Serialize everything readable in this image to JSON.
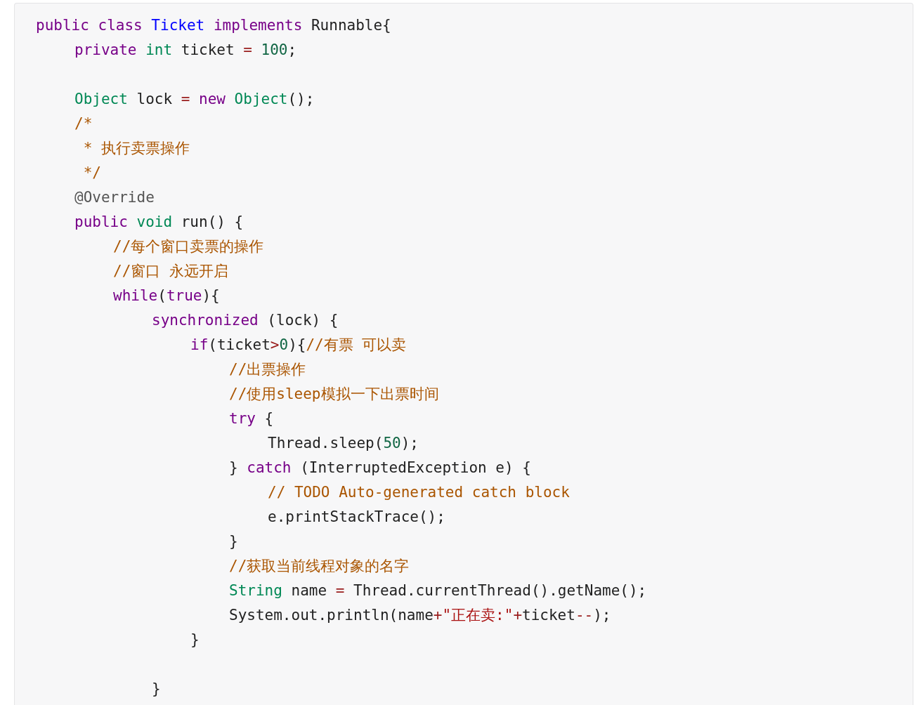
{
  "code_block": {
    "lines": [
      {
        "kind": "code",
        "tokens": [
          {
            "t": "public",
            "kind": "keyword"
          },
          {
            "t": " class",
            "kind": "keyword"
          },
          {
            "t": " Ticket",
            "kind": "classname"
          },
          {
            "t": " implements",
            "kind": "keyword"
          },
          {
            "t": " Runnable{",
            "kind": "plain"
          }
        ],
        "children": [
          {
            "kind": "code",
            "tokens": [
              {
                "t": "private",
                "kind": "keyword"
              },
              {
                "t": " int",
                "kind": "type"
              },
              {
                "t": " ticket ",
                "kind": "plain"
              },
              {
                "t": "=",
                "kind": "operator"
              },
              {
                "t": " 100",
                "kind": "number"
              },
              {
                "t": ";",
                "kind": "plain"
              }
            ]
          },
          {
            "kind": "blank"
          },
          {
            "kind": "code",
            "tokens": [
              {
                "t": "Object",
                "kind": "type"
              },
              {
                "t": " lock ",
                "kind": "plain"
              },
              {
                "t": "=",
                "kind": "operator"
              },
              {
                "t": " new",
                "kind": "keyword"
              },
              {
                "t": " Object",
                "kind": "type"
              },
              {
                "t": "();",
                "kind": "plain"
              }
            ]
          },
          {
            "kind": "code",
            "tokens": [
              {
                "t": "/*",
                "kind": "comment"
              }
            ]
          },
          {
            "kind": "code",
            "tokens": [
              {
                "t": " * 执行卖票操作",
                "kind": "comment"
              }
            ]
          },
          {
            "kind": "code",
            "tokens": [
              {
                "t": " */",
                "kind": "comment"
              }
            ]
          },
          {
            "kind": "code",
            "tokens": [
              {
                "t": "@Override",
                "kind": "meta"
              }
            ]
          },
          {
            "kind": "code",
            "tokens": [
              {
                "t": "public",
                "kind": "keyword"
              },
              {
                "t": " void",
                "kind": "type"
              },
              {
                "t": " run() {",
                "kind": "plain"
              }
            ],
            "children": [
              {
                "kind": "code",
                "tokens": [
                  {
                    "t": "//每个窗口卖票的操作",
                    "kind": "comment"
                  }
                ]
              },
              {
                "kind": "code",
                "tokens": [
                  {
                    "t": "//窗口 永远开启",
                    "kind": "comment"
                  }
                ]
              },
              {
                "kind": "code",
                "tokens": [
                  {
                    "t": "while",
                    "kind": "keyword"
                  },
                  {
                    "t": "(",
                    "kind": "plain"
                  },
                  {
                    "t": "true",
                    "kind": "keyword"
                  },
                  {
                    "t": "){",
                    "kind": "plain"
                  }
                ],
                "children": [
                  {
                    "kind": "code",
                    "tokens": [
                      {
                        "t": "synchronized",
                        "kind": "keyword"
                      },
                      {
                        "t": " (lock) {",
                        "kind": "plain"
                      }
                    ],
                    "children": [
                      {
                        "kind": "code",
                        "tokens": [
                          {
                            "t": "if",
                            "kind": "keyword"
                          },
                          {
                            "t": "(ticket",
                            "kind": "plain"
                          },
                          {
                            "t": ">",
                            "kind": "operator"
                          },
                          {
                            "t": "0",
                            "kind": "number"
                          },
                          {
                            "t": "){",
                            "kind": "plain"
                          },
                          {
                            "t": "//有票 可以卖",
                            "kind": "comment"
                          }
                        ],
                        "children": [
                          {
                            "kind": "code",
                            "tokens": [
                              {
                                "t": "//出票操作",
                                "kind": "comment"
                              }
                            ]
                          },
                          {
                            "kind": "code",
                            "tokens": [
                              {
                                "t": "//使用sleep模拟一下出票时间",
                                "kind": "comment"
                              }
                            ]
                          },
                          {
                            "kind": "code",
                            "tokens": [
                              {
                                "t": "try",
                                "kind": "keyword"
                              },
                              {
                                "t": " {",
                                "kind": "plain"
                              }
                            ],
                            "children": [
                              {
                                "kind": "code",
                                "tokens": [
                                  {
                                    "t": "Thread.sleep(",
                                    "kind": "plain"
                                  },
                                  {
                                    "t": "50",
                                    "kind": "number"
                                  },
                                  {
                                    "t": ");",
                                    "kind": "plain"
                                  }
                                ]
                              }
                            ]
                          },
                          {
                            "kind": "code",
                            "tokens": [
                              {
                                "t": "}",
                                "kind": "plain"
                              },
                              {
                                "t": " catch",
                                "kind": "keyword"
                              },
                              {
                                "t": " (InterruptedException e) {",
                                "kind": "plain"
                              }
                            ],
                            "children": [
                              {
                                "kind": "code",
                                "tokens": [
                                  {
                                    "t": "// TODO Auto-generated catch block",
                                    "kind": "comment"
                                  }
                                ]
                              },
                              {
                                "kind": "code",
                                "tokens": [
                                  {
                                    "t": "e.printStackTrace();",
                                    "kind": "plain"
                                  }
                                ]
                              }
                            ]
                          },
                          {
                            "kind": "code",
                            "tokens": [
                              {
                                "t": "}",
                                "kind": "plain"
                              }
                            ]
                          },
                          {
                            "kind": "code",
                            "tokens": [
                              {
                                "t": "//获取当前线程对象的名字",
                                "kind": "comment"
                              }
                            ]
                          },
                          {
                            "kind": "code",
                            "tokens": [
                              {
                                "t": "String",
                                "kind": "type"
                              },
                              {
                                "t": " name ",
                                "kind": "plain"
                              },
                              {
                                "t": "=",
                                "kind": "operator"
                              },
                              {
                                "t": " Thread.currentThread().getName();",
                                "kind": "plain"
                              }
                            ]
                          },
                          {
                            "kind": "code",
                            "tokens": [
                              {
                                "t": "System.out.println(name",
                                "kind": "plain"
                              },
                              {
                                "t": "+",
                                "kind": "operator"
                              },
                              {
                                "t": "\"正在卖:\"",
                                "kind": "string"
                              },
                              {
                                "t": "+",
                                "kind": "operator"
                              },
                              {
                                "t": "ticket",
                                "kind": "plain"
                              },
                              {
                                "t": "--",
                                "kind": "operator"
                              },
                              {
                                "t": ");",
                                "kind": "plain"
                              }
                            ]
                          }
                        ]
                      },
                      {
                        "kind": "code",
                        "tokens": [
                          {
                            "t": "}",
                            "kind": "plain"
                          }
                        ]
                      },
                      {
                        "kind": "blank"
                      }
                    ]
                  },
                  {
                    "kind": "code",
                    "tokens": [
                      {
                        "t": "}",
                        "kind": "plain"
                      }
                    ]
                  }
                ]
              }
            ]
          }
        ]
      }
    ]
  }
}
